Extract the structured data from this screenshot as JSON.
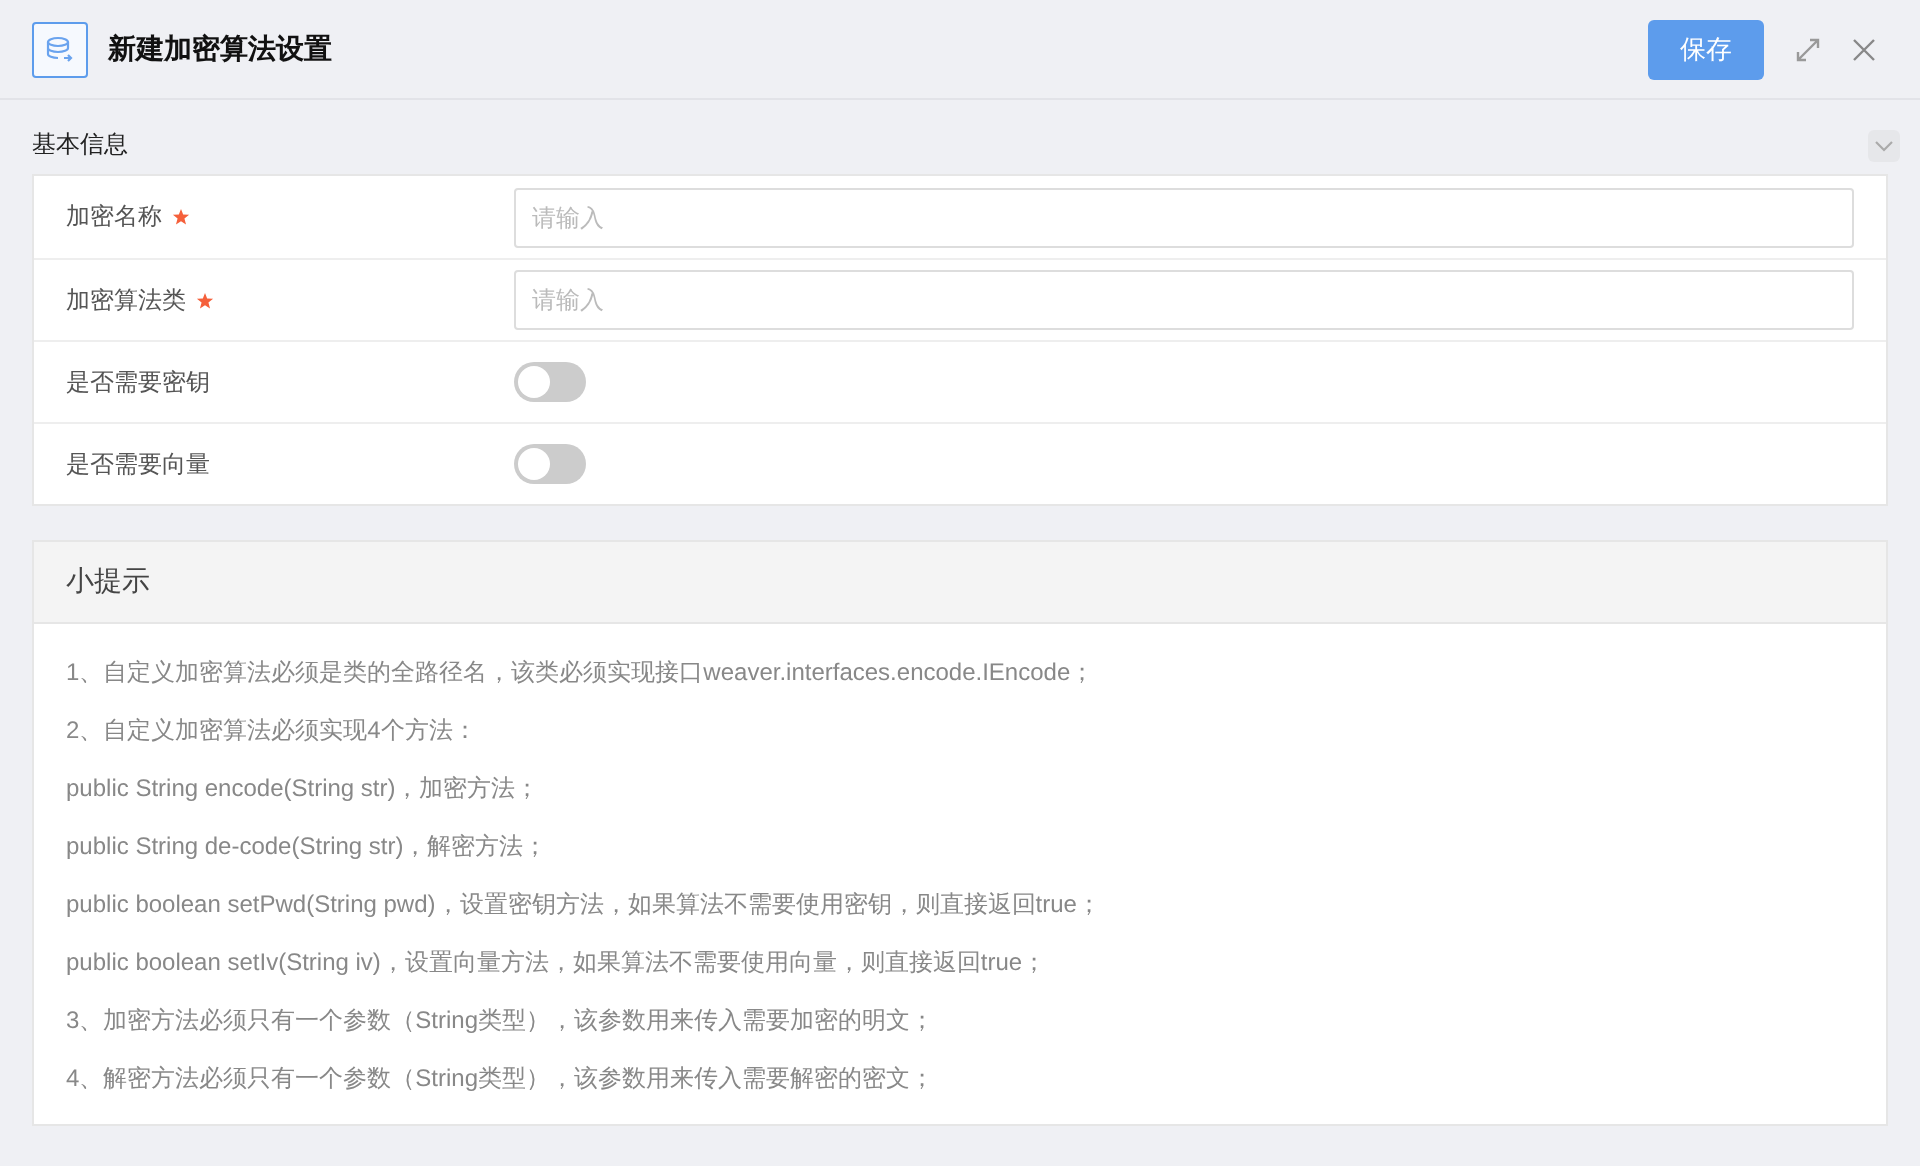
{
  "window": {
    "title": "新建加密算法设置",
    "buttons": [
      "保存"
    ]
  },
  "section": {
    "title": "基本信息",
    "expanded": true
  },
  "fields": [
    {
      "kind": "input",
      "label": "加密名称",
      "required": true,
      "placeholder": "请输入"
    },
    {
      "kind": "input",
      "label": "加密算法类",
      "required": true,
      "placeholder": "请输入"
    },
    {
      "kind": "switch",
      "label": "是否需要密钥",
      "on": false
    },
    {
      "kind": "switch",
      "label": "是否需要向量",
      "on": false
    }
  ],
  "tips": {
    "title": "小提示",
    "lines": [
      "1、自定义加密算法必须是类的全路径名，该类必须实现接口weaver.interfaces.encode.IEncode；",
      "2、自定义加密算法必须实现4个方法：",
      "public String encode(String str)，加密方法；",
      "public String de-code(String str)，解密方法；",
      "public boolean setPwd(String pwd)，设置密钥方法，如果算法不需要使用密钥，则直接返回true；",
      "public boolean setIv(String iv)，设置向量方法，如果算法不需要使用向量，则直接返回true；",
      "3、加密方法必须只有一个参数（String类型），该参数用来传入需要加密的明文；",
      "4、解密方法必须只有一个参数（String类型），该参数用来传入需要解密的密文；"
    ]
  }
}
